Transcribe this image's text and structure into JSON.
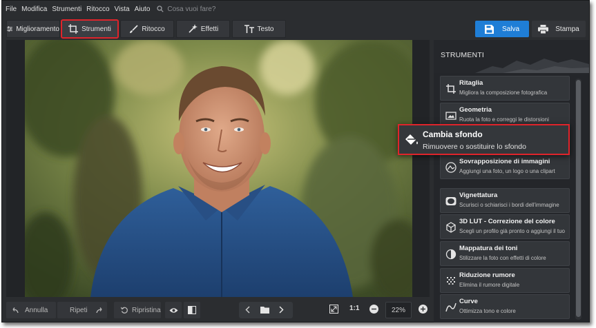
{
  "menu": {
    "items": [
      "File",
      "Modifica",
      "Strumenti",
      "Ritocco",
      "Vista",
      "Aiuto"
    ],
    "search_placeholder": "Cosa vuoi fare?"
  },
  "tabs": [
    {
      "label": "Miglioramento",
      "icon": "sliders-icon"
    },
    {
      "label": "Strumenti",
      "icon": "crop-icon",
      "active": true
    },
    {
      "label": "Ritocco",
      "icon": "brush-icon"
    },
    {
      "label": "Effetti",
      "icon": "magic-wand-icon"
    },
    {
      "label": "Testo",
      "icon": "text-icon"
    }
  ],
  "actions": {
    "save_label": "Salva",
    "print_label": "Stampa"
  },
  "bottom": {
    "undo_label": "Annulla",
    "redo_label": "Ripeti",
    "restore_label": "Ripristina",
    "ratio_label": "1:1",
    "zoom_value": "22%"
  },
  "panel": {
    "title": "STRUMENTI",
    "tools": [
      {
        "title": "Ritaglia",
        "desc": "Migliora la composizione fotografica",
        "icon": "crop-icon"
      },
      {
        "title": "Geometria",
        "desc": "Ruota la foto e correggi le distorsioni",
        "icon": "image-geometry-icon"
      },
      {
        "title": "Sovrapposizione di immagini",
        "desc": "Aggiungi una foto, un logo o una clipart",
        "icon": "overlay-icon"
      },
      {
        "title": "Vignettatura",
        "desc": "Scurisci o schiarisci i bordi dell'immagine",
        "icon": "vignette-icon"
      },
      {
        "title": "3D LUT - Correzione del colore",
        "desc": "Scegli un profilo già pronto o aggiungi il tuo",
        "icon": "lut-icon"
      },
      {
        "title": "Mappatura dei toni",
        "desc": "Stilizzare la foto con effetti di colore",
        "icon": "tone-mapping-icon"
      },
      {
        "title": "Riduzione rumore",
        "desc": "Elimina il rumore digitale",
        "icon": "noise-reduction-icon"
      },
      {
        "title": "Curve",
        "desc": "Ottimizza tono e colore",
        "icon": "curve-icon"
      }
    ],
    "highlight": {
      "title": "Cambia sfondo",
      "desc": "Rimuovere o sostituire lo sfondo",
      "icon": "paint-bucket-icon"
    }
  },
  "colors": {
    "accent_blue": "#1f7ed6",
    "highlight_red": "#e0242b",
    "window_bg": "#2b2d30",
    "panel_bg": "#24262a"
  }
}
